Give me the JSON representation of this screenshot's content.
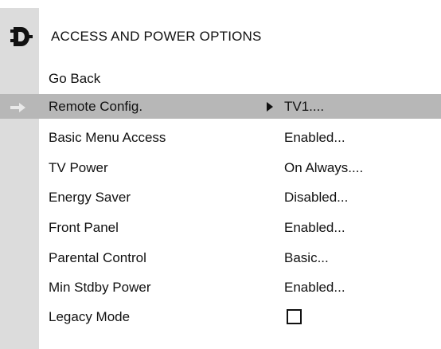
{
  "menu": {
    "title": "ACCESS AND POWER OPTIONS",
    "header_icon": "power-plug-icon",
    "go_back_label": "Go Back",
    "selected_index": 0,
    "accent_colors": {
      "selected_row": "#b7b7b7",
      "sidebar": "#dcdcdc"
    },
    "items": [
      {
        "label": "Remote Config.",
        "value": "TV1....",
        "has_submenu_arrow": true
      },
      {
        "label": "Basic Menu Access",
        "value": "Enabled..."
      },
      {
        "label": "TV Power",
        "value": "On Always...."
      },
      {
        "label": "Energy Saver",
        "value": "Disabled..."
      },
      {
        "label": "Front Panel",
        "value": "Enabled..."
      },
      {
        "label": "Parental Control",
        "value": "Basic..."
      },
      {
        "label": "Min Stdby Power",
        "value": "Enabled..."
      },
      {
        "label": "Legacy Mode",
        "checkbox_checked": false
      }
    ]
  }
}
